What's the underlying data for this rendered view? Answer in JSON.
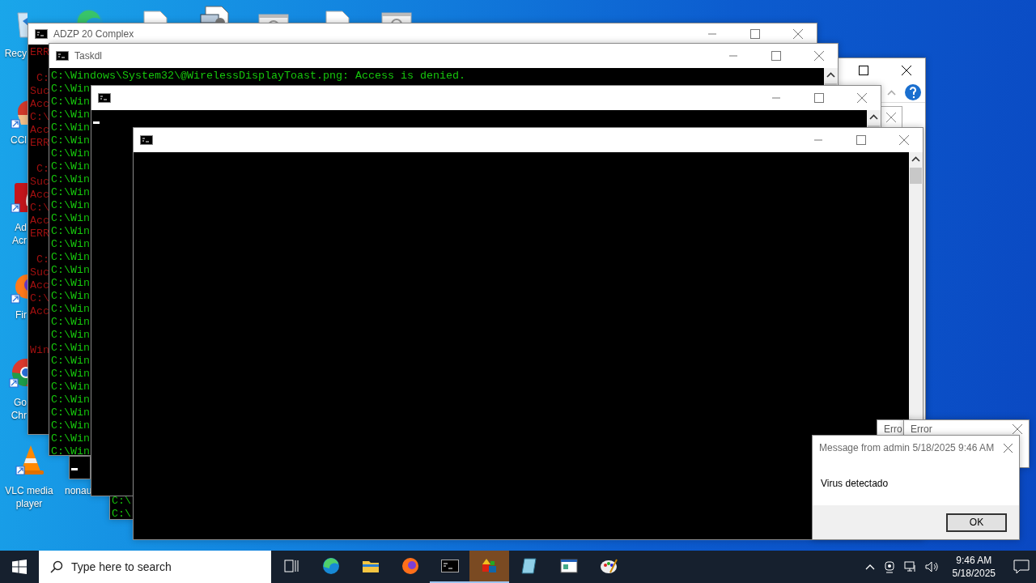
{
  "desktop_icons": [
    {
      "kind": "recycle-bin",
      "lines": [
        "Recy"
      ]
    },
    {
      "kind": "browser"
    },
    {
      "kind": "file"
    },
    {
      "kind": "image-file"
    },
    {
      "kind": "settings-file"
    },
    {
      "kind": "file"
    },
    {
      "kind": "settings-file"
    },
    {
      "kind": "cleaner",
      "lines": [
        "CCl"
      ]
    },
    {
      "kind": "pdf",
      "lines": [
        "Ad",
        "Acr"
      ]
    },
    {
      "kind": "fox",
      "lines": [
        "Fir"
      ]
    },
    {
      "kind": "chrome",
      "lines": [
        "Go",
        "Chr"
      ]
    },
    {
      "kind": "cone",
      "lines": [
        "VLC media player"
      ]
    },
    {
      "lines": [
        "nonau"
      ]
    }
  ],
  "windows": [
    {
      "kind": "dialog"
    },
    {
      "kind": "log-console",
      "title": "ADZP 20 Complex",
      "color": "#a01010",
      "lines": [
        {
          "kind": "text",
          "text": "ERR"
        },
        {
          "kind": "blank"
        },
        {
          "kind": "text",
          "text": " C:"
        },
        {
          "kind": "text",
          "text": "Suc"
        },
        {
          "kind": "text",
          "text": "Acc"
        },
        {
          "kind": "text",
          "text": "C:\\"
        },
        {
          "kind": "text",
          "text": "Acc"
        },
        {
          "kind": "text",
          "text": "ERR"
        },
        {
          "kind": "blank"
        },
        {
          "kind": "text",
          "text": " C:"
        },
        {
          "kind": "text",
          "text": "Suc"
        },
        {
          "kind": "text",
          "text": "Acc"
        },
        {
          "kind": "text",
          "text": "C:\\"
        },
        {
          "kind": "text",
          "text": "Acc"
        },
        {
          "kind": "text",
          "text": "ERR"
        },
        {
          "kind": "blank"
        },
        {
          "kind": "text",
          "text": " C:"
        },
        {
          "kind": "text",
          "text": "Suc"
        },
        {
          "kind": "text",
          "text": "Acc"
        },
        {
          "kind": "text",
          "text": "C:\\"
        },
        {
          "kind": "text",
          "text": "Acc"
        },
        {
          "kind": "blank"
        },
        {
          "kind": "blank"
        },
        {
          "kind": "text",
          "text": "Win"
        }
      ]
    },
    {
      "kind": "console-fragment",
      "lines": [
        {
          "kind": "cursor"
        }
      ]
    },
    {
      "kind": "titled-console",
      "title": "Taskdl",
      "color": "#16c60c",
      "lines": [
        {
          "kind": "text",
          "text": "C:\\Windows\\System32\\@WirelessDisplayToast.png: Access is denied."
        },
        {
          "kind": "text",
          "text": "C:\\Win"
        },
        {
          "kind": "text",
          "text": "C:\\Win"
        },
        {
          "kind": "text",
          "text": "C:\\Win"
        },
        {
          "kind": "text",
          "text": "C:\\Win"
        },
        {
          "kind": "text",
          "text": "C:\\Win"
        },
        {
          "kind": "text",
          "text": "C:\\Win"
        },
        {
          "kind": "text",
          "text": "C:\\Win"
        },
        {
          "kind": "text",
          "text": "C:\\Win"
        },
        {
          "kind": "text",
          "text": "C:\\Win"
        },
        {
          "kind": "text",
          "text": "C:\\Win"
        },
        {
          "kind": "text",
          "text": "C:\\Win"
        },
        {
          "kind": "text",
          "text": "C:\\Win"
        },
        {
          "kind": "text",
          "text": "C:\\Win"
        },
        {
          "kind": "text",
          "text": "C:\\Win"
        },
        {
          "kind": "text",
          "text": "C:\\Win"
        },
        {
          "kind": "text",
          "text": "C:\\Win"
        },
        {
          "kind": "text",
          "text": "C:\\Win"
        },
        {
          "kind": "text",
          "text": "C:\\Win"
        },
        {
          "kind": "text",
          "text": "C:\\Win"
        },
        {
          "kind": "text",
          "text": "C:\\Win"
        },
        {
          "kind": "text",
          "text": "C:\\Win"
        },
        {
          "kind": "text",
          "text": "C:\\Win"
        },
        {
          "kind": "text",
          "text": "C:\\Win"
        },
        {
          "kind": "text",
          "text": "C:\\Win"
        },
        {
          "kind": "text",
          "text": "C:\\Win"
        },
        {
          "kind": "text",
          "text": "C:\\Win"
        },
        {
          "kind": "text",
          "text": "C:\\Win"
        },
        {
          "kind": "text",
          "text": "C:\\Win"
        },
        {
          "kind": "text",
          "text": "C:\\Win"
        }
      ]
    },
    {
      "kind": "console-fragment",
      "color": "#16c60c",
      "lines": [
        {
          "kind": "text",
          "text": "C:\\"
        },
        {
          "kind": "text",
          "text": "C:\\"
        }
      ]
    },
    {
      "kind": "titled-console",
      "lines": [
        {
          "kind": "cursor"
        }
      ]
    },
    {
      "kind": "titled-console"
    },
    {
      "kind": "error",
      "title": "Erro"
    },
    {
      "kind": "error",
      "title": "Error",
      "close": true
    },
    {
      "kind": "message",
      "title": "Message from admin 5/18/2025 9:46 AM",
      "text": "Virus detectado",
      "button": "OK"
    }
  ],
  "taskbar": {
    "search": {
      "placeholder": "Type here to search"
    },
    "apps": [
      {
        "kind": "task-view",
        "running": false,
        "selected": false
      },
      {
        "kind": "edge",
        "running": false,
        "selected": false
      },
      {
        "kind": "folder",
        "running": false,
        "selected": false
      },
      {
        "kind": "fox",
        "running": false,
        "selected": false
      },
      {
        "kind": "terminal",
        "running": true,
        "selected": false
      },
      {
        "kind": "shapes",
        "running": true,
        "selected": true
      },
      {
        "kind": "notebook",
        "running": false,
        "selected": false
      },
      {
        "kind": "window",
        "running": false,
        "selected": false
      },
      {
        "kind": "palette",
        "running": false,
        "selected": false
      }
    ],
    "clock": {
      "time": "9:46 AM",
      "date": "5/18/2025"
    }
  }
}
